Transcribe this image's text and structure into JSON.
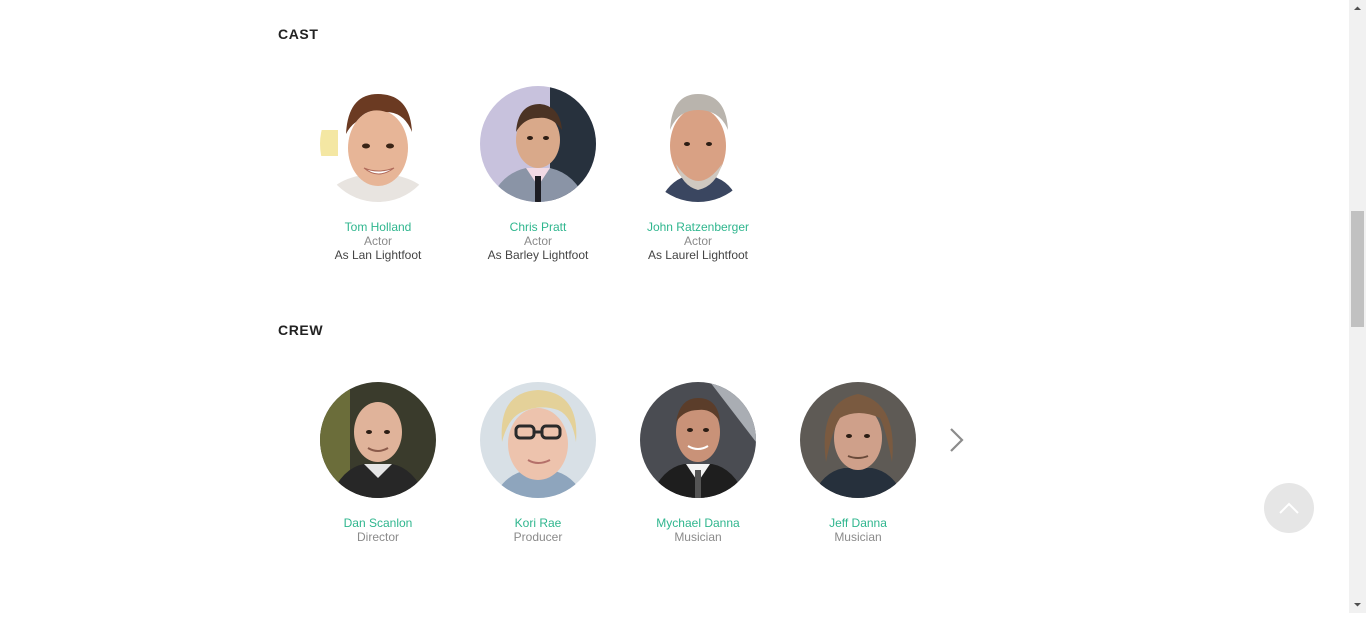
{
  "cast": {
    "title": "CAST",
    "people": [
      {
        "name": "Tom Holland",
        "role": "Actor",
        "character": "As Lan Lightfoot"
      },
      {
        "name": "Chris Pratt",
        "role": "Actor",
        "character": "As Barley Lightfoot"
      },
      {
        "name": "John Ratzenberger",
        "role": "Actor",
        "character": "As Laurel Lightfoot"
      }
    ]
  },
  "crew": {
    "title": "CREW",
    "people": [
      {
        "name": "Dan Scanlon",
        "role": "Director"
      },
      {
        "name": "Kori Rae",
        "role": "Producer"
      },
      {
        "name": "Mychael Danna",
        "role": "Musician"
      },
      {
        "name": "Jeff Danna",
        "role": "Musician"
      }
    ]
  },
  "icons": {
    "next": "chevron-right-icon",
    "back_to_top": "chevron-up-icon"
  },
  "colors": {
    "name_link": "#2fb68e",
    "role_text": "#8a8a8a",
    "character_text": "#444444",
    "back_to_top_bg": "#e6e6e6"
  }
}
